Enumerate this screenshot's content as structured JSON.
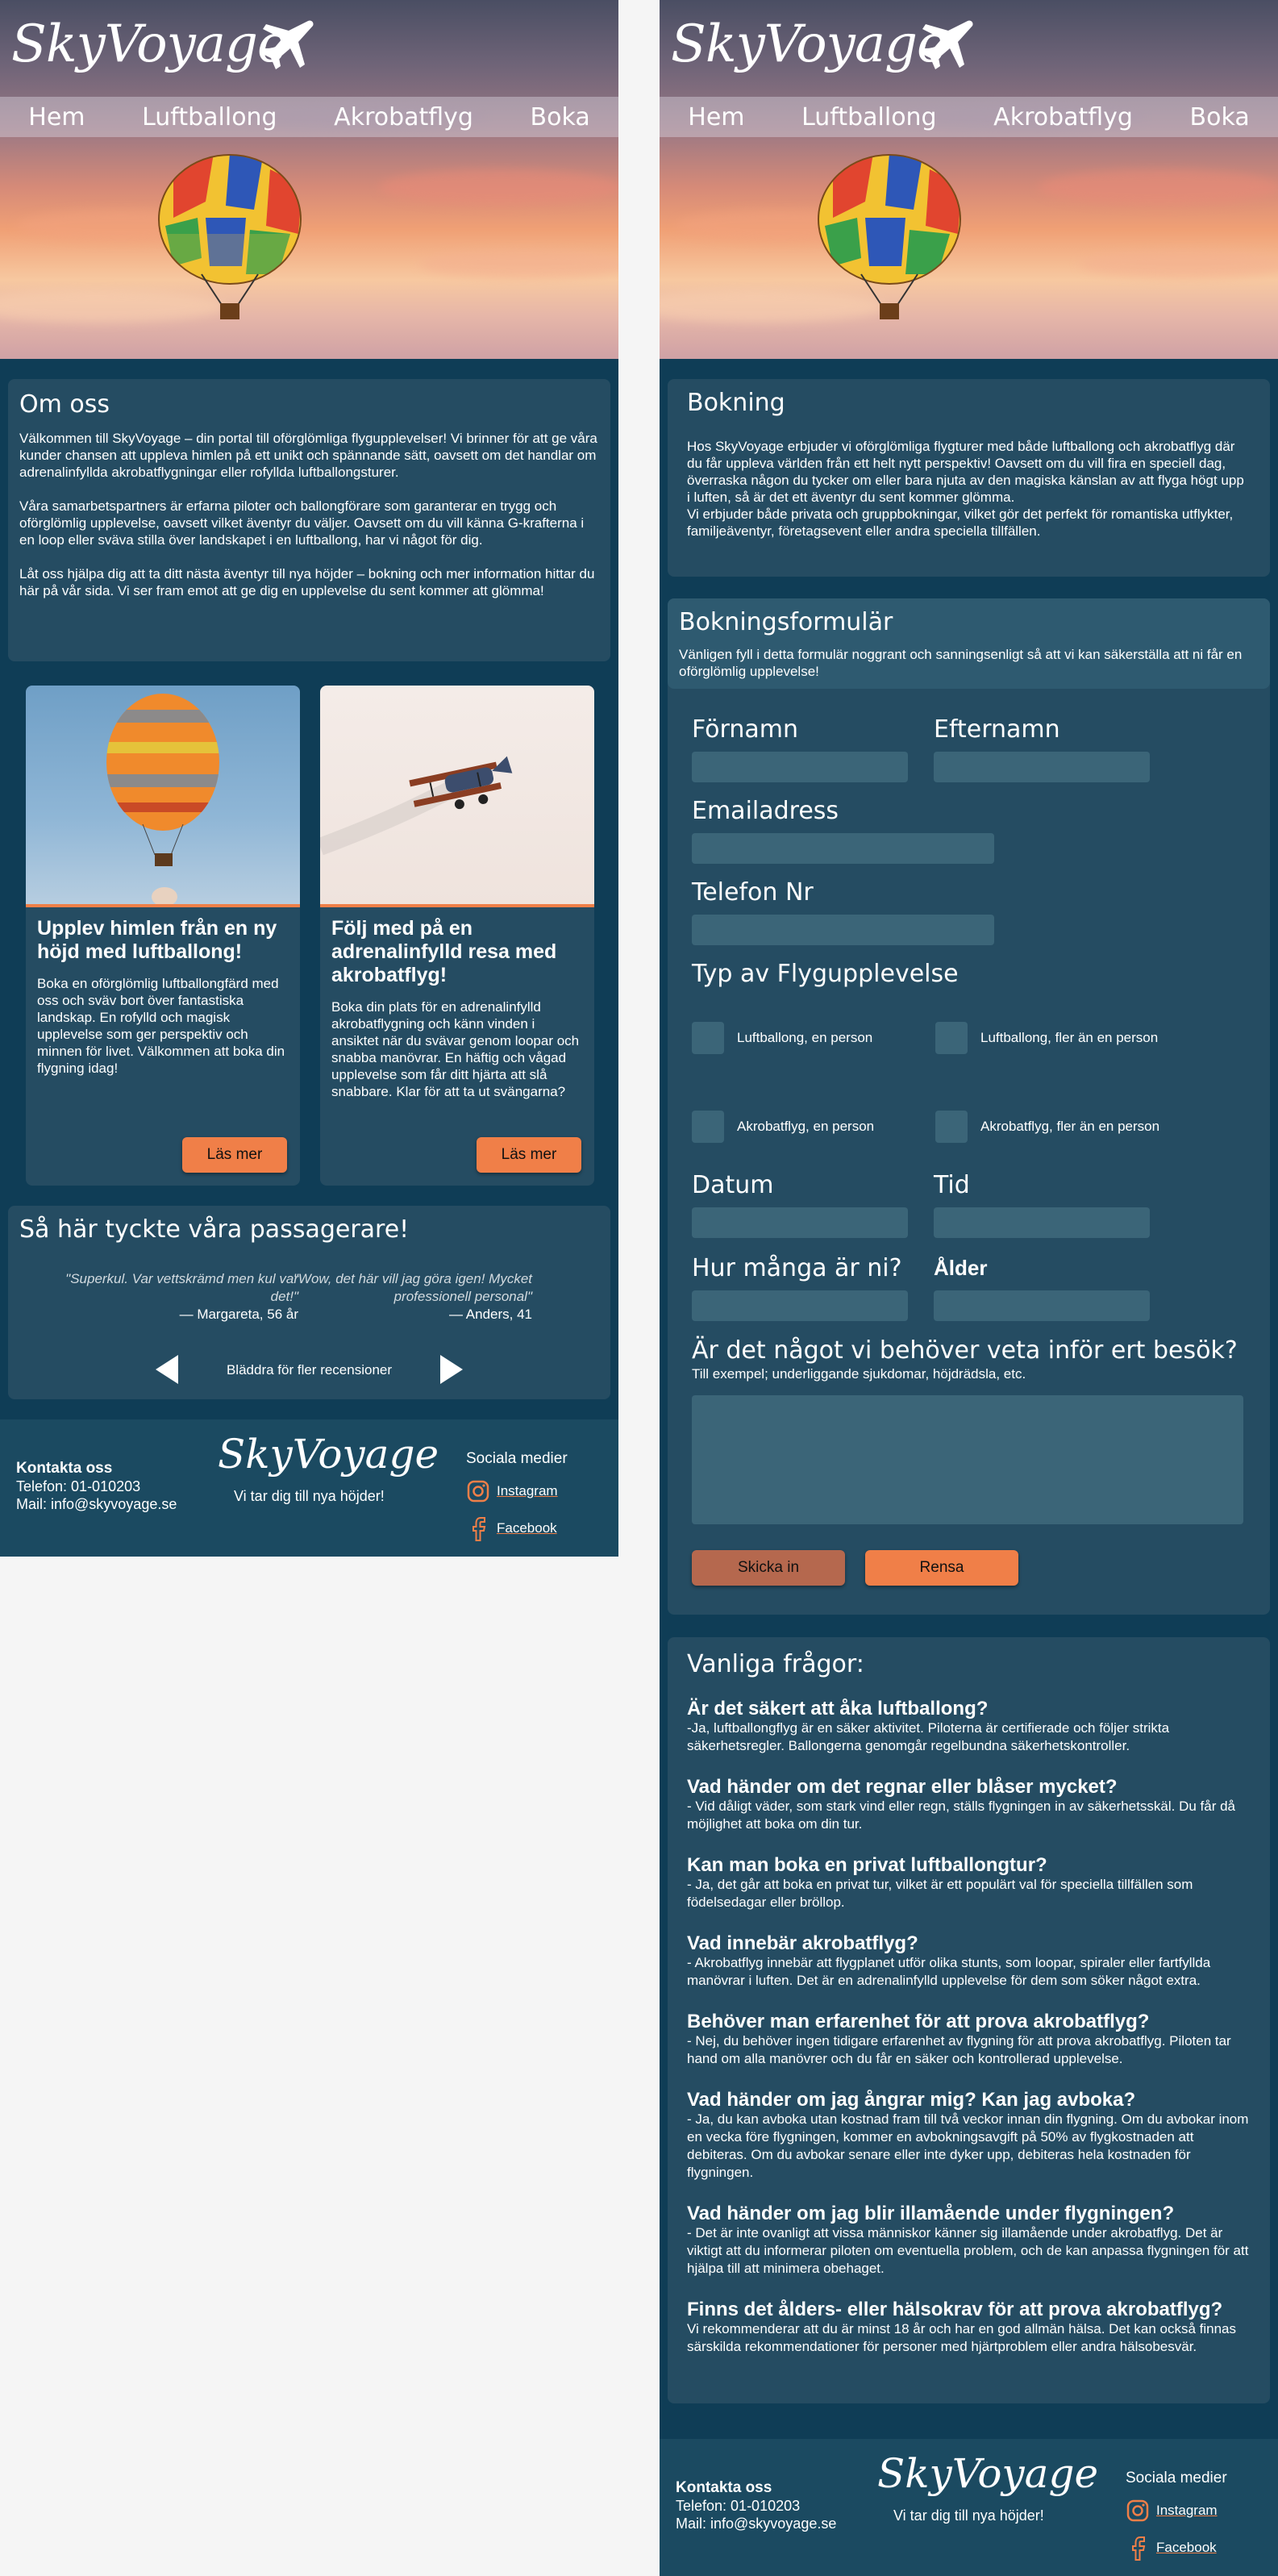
{
  "brand": {
    "logo_text": "SkyVoyage",
    "tagline": "Vi tar dig till nya höjder!"
  },
  "nav": {
    "items": [
      "Hem",
      "Luftballong",
      "Akrobatflyg",
      "Boka"
    ]
  },
  "home": {
    "about": {
      "title": "Om oss",
      "paragraphs": [
        "Välkommen till SkyVoyage – din portal till oförglömliga flygupplevelser! Vi brinner för att ge våra kunder chansen att uppleva himlen på ett unikt och spännande sätt, oavsett om det handlar om adrenalinfyllda akrobatflygningar eller rofyllda luftballongsturer.",
        "Våra samarbetspartners är erfarna piloter och ballongförare som garanterar en trygg och oförglömlig upplevelse, oavsett vilket äventyr du väljer. Oavsett om du vill känna G-krafterna i en loop eller sväva stilla över landskapet i en luftballong, har vi något för dig.",
        "Låt oss hjälpa dig att ta ditt nästa äventyr till nya höjder – bokning och mer information hittar du här på vår sida. Vi ser fram emot att ge dig en upplevelse du sent kommer att glömma!"
      ]
    },
    "cards": [
      {
        "title": "Upplev himlen från en ny höjd med luftballong!",
        "text": "Boka en oförglömlig luftballongfärd med oss och sväv bort över fantastiska landskap. En rofylld och magisk upplevelse som ger perspektiv och minnen för livet. Välkommen att boka din flygning idag!",
        "button": "Läs mer"
      },
      {
        "title": "Följ med på en adrenalinfylld resa med akrobatflyg!",
        "text": "Boka din plats för en adrenalinfylld akrobatflygning och känn vinden i ansiktet när du svävar genom loopar och snabba manövrar. En häftig och vågad upplevelse som får ditt hjärta att slå snabbare. Klar för att ta ut svängarna?",
        "button": "Läs mer"
      }
    ],
    "reviews": {
      "title": "Så här tyckte våra passagerare!",
      "items": [
        {
          "quote": "\"Superkul. Var vettskrämd men kul var det!\"",
          "author": "— Margareta, 56 år"
        },
        {
          "quote": "\"Wow, det här vill jag göra igen! Mycket professionell personal\"",
          "author": "— Anders, 41"
        }
      ],
      "nav_label": "Bläddra för fler recensioner"
    }
  },
  "booking": {
    "intro": {
      "title": "Bokning",
      "paragraphs": [
        "Hos SkyVoyage erbjuder vi oförglömliga flygturer med både luftballong och akrobatflyg där du får uppleva världen från ett helt nytt perspektiv! Oavsett om du vill fira en speciell dag, överraska någon du tycker om eller bara njuta av den magiska känslan av att flyga högt upp i luften, så är det ett äventyr du sent kommer glömma.",
        "Vi erbjuder både privata och gruppbokningar, vilket gör det perfekt för romantiska utflykter, familjeäventyr, företagsevent eller andra speciella tillfällen."
      ]
    },
    "form": {
      "title": "Bokningsformulär",
      "subtitle": "Vänligen fyll i detta formulär noggrant och sanningsenligt så att vi kan säkerställa att ni får en oförglömlig upplevelse!",
      "first_name": "Förnamn",
      "last_name": "Efternamn",
      "email": "Emailadress",
      "phone": "Telefon Nr",
      "type_title": "Typ av Flygupplevelse",
      "options": [
        "Luftballong, en person",
        "Luftballong, fler än en person",
        "Akrobatflyg, en person",
        "Akrobatflyg, fler än en person"
      ],
      "date": "Datum",
      "time": "Tid",
      "count": "Hur många är ni?",
      "age": "Ålder",
      "needs": "Är det något vi behöver veta inför ert besök?",
      "needs_hint": "Till exempel; underliggande sjukdomar, höjdrädsla, etc.",
      "submit": "Skicka in",
      "reset": "Rensa"
    },
    "faq": {
      "title": "Vanliga frågor:",
      "items": [
        {
          "q": "Är det säkert att åka luftballong?",
          "a": "-Ja, luftballongflyg är en säker aktivitet. Piloterna är certifierade och följer strikta säkerhetsregler. Ballongerna genomgår regelbundna säkerhetskontroller."
        },
        {
          "q": "Vad händer om det regnar eller blåser mycket?",
          "a": "- Vid dåligt väder, som stark vind eller regn, ställs flygningen in av säkerhetsskäl. Du får då möjlighet att boka om din tur."
        },
        {
          "q": "Kan man boka en privat luftballongtur?",
          "a": "- Ja, det går att boka en privat tur, vilket är ett populärt val för speciella tillfällen som födelsedagar eller bröllop."
        },
        {
          "q": "Vad innebär akrobatflyg?",
          "a": "- Akrobatflyg innebär att flygplanet utför olika stunts, som loopar, spiraler eller fartfyllda manövrar i luften. Det är en adrenalinfylld    upplevelse för dem som söker något extra."
        },
        {
          "q": "Behöver man erfarenhet för att prova akrobatflyg?",
          "a": "- Nej, du behöver ingen tidigare erfarenhet av flygning för att prova akrobatflyg. Piloten tar hand om alla manövrer och du får en säker och kontrollerad upplevelse."
        },
        {
          "q": "Vad händer om jag ångrar mig? Kan jag avboka?",
          "a": "- Ja, du kan avboka utan kostnad fram till två veckor innan din flygning. Om du avbokar inom en vecka före flygningen, kommer en avbokningsavgift på 50% av flygkostnaden att debiteras. Om du avbokar senare eller inte dyker upp, debiteras hela kostnaden för flygningen."
        },
        {
          "q": "Vad händer om jag blir illamående under flygningen?",
          "a": "- Det är inte ovanligt att vissa människor känner sig illamående under akrobatflyg. Det är viktigt att du informerar piloten om eventuella problem, och de kan anpassa flygningen för att hjälpa till att minimera obehaget."
        },
        {
          "q": "Finns det ålders- eller hälsokrav för att prova akrobatflyg?",
          "a": "Vi rekommenderar att du är minst 18 år och har en god allmän hälsa. Det kan också finnas särskilda rekommendationer för personer med hjärtproblem eller andra hälsobesvär."
        }
      ]
    }
  },
  "footer": {
    "contact_title": "Kontakta oss",
    "phone": "Telefon: 01-010203",
    "mail": "Mail: info@skyvoyage.se",
    "social_title": "Sociala medier",
    "instagram": "Instagram",
    "facebook": "Facebook"
  },
  "colors": {
    "background": "#0f3d56",
    "panel": "#254c62",
    "accent": "#f07f48"
  }
}
